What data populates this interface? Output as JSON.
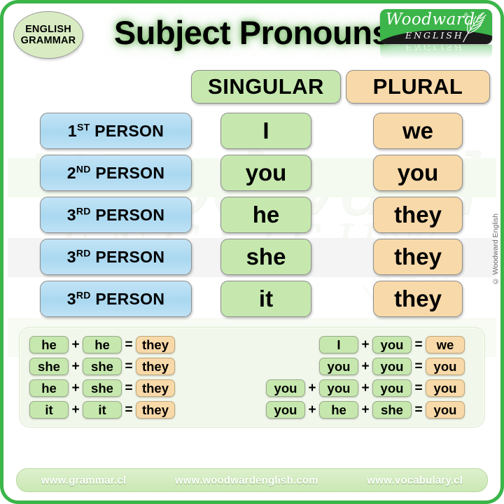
{
  "badge": {
    "line1": "ENGLISH",
    "line2": "GRAMMAR"
  },
  "title": "Subject Pronouns",
  "logo": {
    "word": "Woodward",
    "reg": "®",
    "sub": "ENGLISH"
  },
  "watermark": {
    "script": "Woodward",
    "sub": "ENGLISH"
  },
  "columns": {
    "singular": "SINGULAR",
    "plural": "PLURAL"
  },
  "rows": [
    {
      "ordinal": "1",
      "suffix": "ST",
      "person": " PERSON",
      "singular": "I",
      "plural": "we"
    },
    {
      "ordinal": "2",
      "suffix": "ND",
      "person": " PERSON",
      "singular": "you",
      "plural": "you"
    },
    {
      "ordinal": "3",
      "suffix": "RD",
      "person": " PERSON",
      "singular": "he",
      "plural": "they"
    },
    {
      "ordinal": "3",
      "suffix": "RD",
      "person": " PERSON",
      "singular": "she",
      "plural": "they"
    },
    {
      "ordinal": "3",
      "suffix": "RD",
      "person": " PERSON",
      "singular": "it",
      "plural": "they"
    }
  ],
  "equations": {
    "left": [
      {
        "terms": [
          "he",
          "he"
        ],
        "result": "they"
      },
      {
        "terms": [
          "she",
          "she"
        ],
        "result": "they"
      },
      {
        "terms": [
          "he",
          "she"
        ],
        "result": "they"
      },
      {
        "terms": [
          "it",
          "it"
        ],
        "result": "they"
      }
    ],
    "right": [
      {
        "terms": [
          "I",
          "you"
        ],
        "result": "we"
      },
      {
        "terms": [
          "you",
          "you"
        ],
        "result": "you"
      },
      {
        "terms": [
          "you",
          "you",
          "you"
        ],
        "result": "you"
      },
      {
        "terms": [
          "you",
          "he",
          "she"
        ],
        "result": "you"
      }
    ],
    "plus": "+",
    "equals": "="
  },
  "footer": {
    "links": [
      "www.grammar.cl",
      "www.woodwardenglish.com",
      "www.vocabulary.cl"
    ]
  },
  "copyright": "© Woodward English",
  "colors": {
    "frame_green": "#3cb54a",
    "singular_green": "#c6e8ae",
    "plural_peach": "#f8d9a9",
    "person_blue": "#a9d8f0",
    "panel_bg": "#f1f7ea"
  }
}
